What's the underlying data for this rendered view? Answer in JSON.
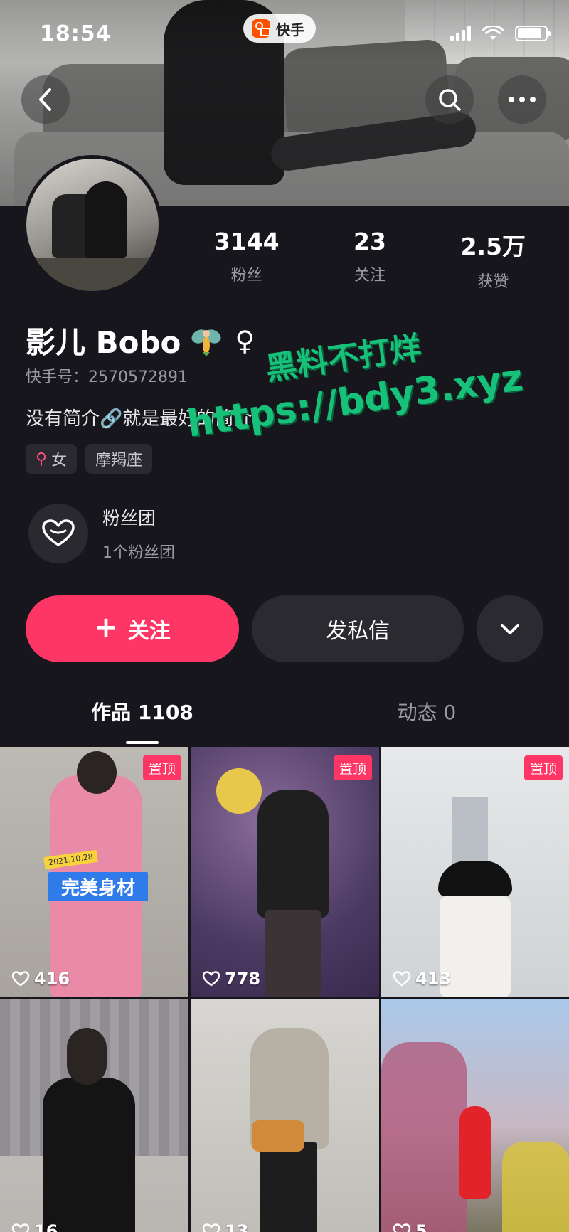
{
  "status_bar": {
    "time": "18:54",
    "app_name": "快手"
  },
  "profile": {
    "stats": [
      {
        "value": "3144",
        "label": "粉丝"
      },
      {
        "value": "23",
        "label": "关注"
      },
      {
        "value": "2.5万",
        "label": "获赞"
      }
    ],
    "name": "影儿 Bobo",
    "gender_symbol": "♀",
    "uid": "快手号：2570572891",
    "bio": "没有简介🔗就是最好的简介",
    "tags": [
      {
        "label": "女",
        "icon": "female-icon"
      },
      {
        "label": "摩羯座"
      }
    ],
    "fan_club": {
      "title": "粉丝团",
      "subtitle": "1个粉丝团"
    }
  },
  "actions": {
    "follow_label": "关注",
    "message_label": "发私信"
  },
  "tabs": [
    {
      "label": "作品 1108",
      "active": true
    },
    {
      "label": "动态 0",
      "active": false
    }
  ],
  "videos": [
    {
      "likes": "416",
      "pinned": "置顶",
      "sticker": "完美身材",
      "sticker_date": "2021.10.28"
    },
    {
      "likes": "778",
      "pinned": "置顶"
    },
    {
      "likes": "413",
      "pinned": "置顶"
    },
    {
      "likes": "16"
    },
    {
      "likes": "13"
    },
    {
      "likes": "5"
    }
  ],
  "watermark": {
    "line1": "黑料不打烊",
    "line2": "https://bdy3.xyz"
  },
  "colors": {
    "accent": "#fe3666",
    "background": "#17161c",
    "secondary_text": "#9a99a0"
  }
}
